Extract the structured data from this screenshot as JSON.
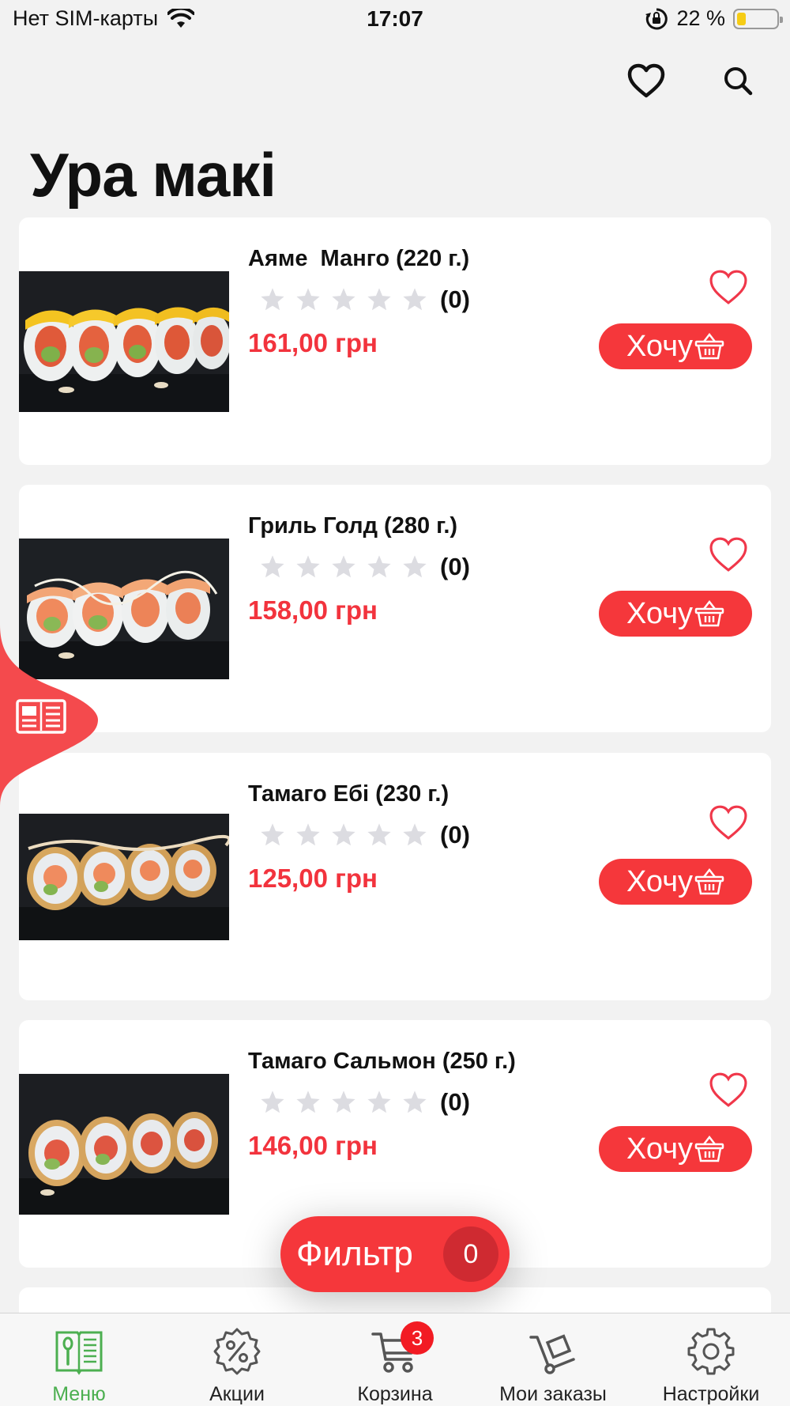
{
  "status_bar": {
    "carrier": "Нет SIM-карты",
    "time": "17:07",
    "battery": "22 %",
    "battery_level": 0.22
  },
  "header": {
    "title": "Ура макі"
  },
  "products": [
    {
      "name": "Аяме  Манго (220 г.)",
      "rating_count": "(0)",
      "price": "161,00 грн",
      "button": "Хочу"
    },
    {
      "name": "Гриль Голд (280 г.)",
      "rating_count": "(0)",
      "price": "158,00 грн",
      "button": "Хочу"
    },
    {
      "name": "Тамаго Ебі (230 г.)",
      "rating_count": "(0)",
      "price": "125,00 грн",
      "button": "Хочу"
    },
    {
      "name": "Тамаго Сальмон (250 г.)",
      "rating_count": "(0)",
      "price": "146,00 грн",
      "button": "Хочу"
    }
  ],
  "filter": {
    "label": "Фильтр",
    "count": "0"
  },
  "tabbar": {
    "tabs": [
      {
        "label": "Меню",
        "icon": "menu-book-icon"
      },
      {
        "label": "Акции",
        "icon": "percent-badge-icon"
      },
      {
        "label": "Корзина",
        "icon": "cart-icon"
      },
      {
        "label": "Мои заказы",
        "icon": "hand-truck-icon"
      },
      {
        "label": "Настройки",
        "icon": "gear-icon"
      }
    ],
    "cart_badge": "3"
  },
  "colors": {
    "accent": "#f5373b",
    "active_tab": "#4caf50",
    "star": "#dcdce1",
    "background": "#f2f2f2"
  }
}
